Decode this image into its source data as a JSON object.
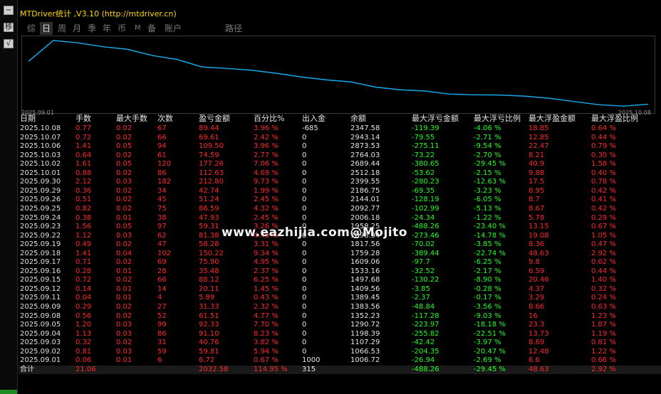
{
  "window": {
    "title": "MTDriver统计 ,V3.10 (http://mtdriver.cn)"
  },
  "sidebar": {
    "btn_minimize": "−",
    "btn_move": "移",
    "btn_check": "√"
  },
  "tabs": [
    {
      "label": "综",
      "active": false
    },
    {
      "label": "日",
      "active": true
    },
    {
      "label": "周",
      "active": false
    },
    {
      "label": "月",
      "active": false
    },
    {
      "label": "季",
      "active": false
    },
    {
      "label": "年",
      "active": false
    },
    {
      "label": "币",
      "active": false
    },
    {
      "label": "M",
      "active": false
    },
    {
      "label": "备",
      "active": false
    },
    {
      "label": "账户",
      "active": false
    },
    {
      "label": "路径",
      "active": false
    }
  ],
  "chart_data": {
    "type": "line",
    "color": "#16a8ea",
    "x_start_label": "2025.09.01",
    "x_end_label": "2025.10.08",
    "series": [
      {
        "values": [
          1006.72,
          1066.53,
          1107.29,
          1198.39,
          1290.72,
          1352.23,
          1383.56,
          1389.45,
          1409.56,
          1497.68,
          1533.16,
          1609.06,
          1759.28,
          1817.56,
          1898.94,
          2006.18,
          2092.77,
          2144.01,
          2186.75,
          2399.55,
          2512.18,
          2689.44,
          2764.03,
          2873.53,
          2943.14,
          2347.58
        ]
      }
    ]
  },
  "columns": [
    "日期",
    "手数",
    "最大手数",
    "次数",
    "盈亏金额",
    "百分比%",
    "出入金",
    "余额",
    "最大浮亏金额",
    "最大浮亏比例",
    "最大浮盈金额",
    "最大浮盈比例"
  ],
  "rows": [
    [
      "2025.10.08",
      "0.77",
      "0.02",
      "67",
      "89.44",
      "3.96 %",
      "-685",
      "2347.58",
      "-119.39",
      "-4.06 %",
      "18.85",
      "0.64 %"
    ],
    [
      "2025.10.07",
      "0.72",
      "0.02",
      "66",
      "69.61",
      "2.42 %",
      "0",
      "2943.14",
      "-79.55",
      "-2.71 %",
      "12.85",
      "0.44 %"
    ],
    [
      "2025.10.06",
      "1.41",
      "0.05",
      "94",
      "109.50",
      "3.96 %",
      "0",
      "2873.53",
      "-275.11",
      "-9.54 %",
      "22.47",
      "0.79 %"
    ],
    [
      "2025.10.03",
      "0.64",
      "0.02",
      "61",
      "74.59",
      "2.77 %",
      "0",
      "2764.03",
      "-73.22",
      "-2.70 %",
      "8.21",
      "0.30 %"
    ],
    [
      "2025.10.02",
      "1.61",
      "0.05",
      "120",
      "177.26",
      "7.06 %",
      "0",
      "2689.44",
      "-380.65",
      "-29.45 %",
      "40.9",
      "1.58 %"
    ],
    [
      "2025.10.01",
      "0.88",
      "0.02",
      "86",
      "112.63",
      "4.69 %",
      "0",
      "2512.18",
      "-53.62",
      "-2.15 %",
      "9.88",
      "0.40 %"
    ],
    [
      "2025.09.30",
      "2.12",
      "0.03",
      "182",
      "212.80",
      "9.73 %",
      "0",
      "2399.55",
      "-280.23",
      "-12.63 %",
      "17.5",
      "0.78 %"
    ],
    [
      "2025.09.29",
      "0.36",
      "0.02",
      "34",
      "42.74",
      "1.99 %",
      "0",
      "2186.75",
      "-69.35",
      "-3.23 %",
      "8.95",
      "0.42 %"
    ],
    [
      "2025.09.26",
      "0.51",
      "0.02",
      "45",
      "51.24",
      "2.45 %",
      "0",
      "2144.01",
      "-128.19",
      "-6.05 %",
      "8.7",
      "0.41 %"
    ],
    [
      "2025.09.25",
      "0.82",
      "0.02",
      "75",
      "86.59",
      "4.32 %",
      "0",
      "2092.77",
      "-102.99",
      "-5.13 %",
      "8.67",
      "0.42 %"
    ],
    [
      "2025.09.24",
      "0.38",
      "0.01",
      "38",
      "47.93",
      "2.45 %",
      "0",
      "2006.18",
      "-24.34",
      "-1.22 %",
      "5.78",
      "0.29 %"
    ],
    [
      "2025.09.23",
      "1.56",
      "0.05",
      "97",
      "59.31",
      "3.26 %",
      "0",
      "1958.25",
      "-488.26",
      "-23.40 %",
      "13.15",
      "0.67 %"
    ],
    [
      "2025.09.22",
      "1.12",
      "0.03",
      "62",
      "81.38",
      "4.48 %",
      "0",
      "1898.94",
      "-273.46",
      "-14.78 %",
      "19.08",
      "1.05 %"
    ],
    [
      "2025.09.19",
      "0.49",
      "0.02",
      "47",
      "58.28",
      "3.31 %",
      "0",
      "1817.56",
      "-70.02",
      "-3.85 %",
      "8.36",
      "0.47 %"
    ],
    [
      "2025.09.18",
      "1.41",
      "0.04",
      "102",
      "150.22",
      "9.34 %",
      "0",
      "1759.28",
      "-389.44",
      "-22.74 %",
      "48.63",
      "2.92 %"
    ],
    [
      "2025.09.17",
      "0.71",
      "0.02",
      "69",
      "75.90",
      "4.95 %",
      "0",
      "1609.06",
      "-97.7",
      "-6.25 %",
      "9.8",
      "0.62 %"
    ],
    [
      "2025.09.16",
      "0.28",
      "0.01",
      "28",
      "35.48",
      "2.37 %",
      "0",
      "1533.16",
      "-32.52",
      "-2.17 %",
      "6.59",
      "0.44 %"
    ],
    [
      "2025.09.15",
      "0.72",
      "0.02",
      "66",
      "88.12",
      "6.25 %",
      "0",
      "1497.68",
      "-130.22",
      "-8.90 %",
      "20.46",
      "1.40 %"
    ],
    [
      "2025.09.12",
      "0.14",
      "0.01",
      "14",
      "20.11",
      "1.45 %",
      "0",
      "1409.56",
      "-3.85",
      "-0.28 %",
      "4.37",
      "0.32 %"
    ],
    [
      "2025.09.11",
      "0.04",
      "0.01",
      "4",
      "5.89",
      "0.43 %",
      "0",
      "1389.45",
      "-2.37",
      "-0.17 %",
      "3.29",
      "0.24 %"
    ],
    [
      "2025.09.09",
      "0.29",
      "0.02",
      "27",
      "31.33",
      "2.32 %",
      "0",
      "1383.56",
      "-48.84",
      "-3.56 %",
      "8.66",
      "0.63 %"
    ],
    [
      "2025.09.08",
      "0.56",
      "0.02",
      "52",
      "61.51",
      "4.77 %",
      "0",
      "1352.23",
      "-117.28",
      "-9.03 %",
      "16",
      "1.23 %"
    ],
    [
      "2025.09.05",
      "1.20",
      "0.03",
      "99",
      "92.33",
      "7.70 %",
      "0",
      "1290.72",
      "-223.97",
      "-18.18 %",
      "23.3",
      "1.87 %"
    ],
    [
      "2025.09.04",
      "1.13",
      "0.03",
      "86",
      "91.10",
      "8.23 %",
      "0",
      "1198.39",
      "-255.82",
      "-22.51 %",
      "13.73",
      "1.19 %"
    ],
    [
      "2025.09.03",
      "0.32",
      "0.02",
      "31",
      "40.76",
      "3.82 %",
      "0",
      "1107.29",
      "-42.42",
      "-3.97 %",
      "8.69",
      "0.81 %"
    ],
    [
      "2025.09.02",
      "0.81",
      "0.03",
      "59",
      "59.81",
      "5.94 %",
      "0",
      "1066.53",
      "-204.35",
      "-20.47 %",
      "12.48",
      "1.22 %"
    ],
    [
      "2025.09.01",
      "0.06",
      "0.01",
      "6",
      "6.72",
      "0.67 %",
      "1000",
      "1006.72",
      "-26.94",
      "-2.69 %",
      "6.6",
      "0.66 %"
    ]
  ],
  "total": [
    "合计",
    "21.06",
    "",
    "",
    "2032.58",
    "114.95 %",
    "315",
    "",
    "-488.26",
    "-29.45 %",
    "48.63",
    "2.92 %"
  ],
  "watermark": "www.eazhijia.com@Mojito"
}
